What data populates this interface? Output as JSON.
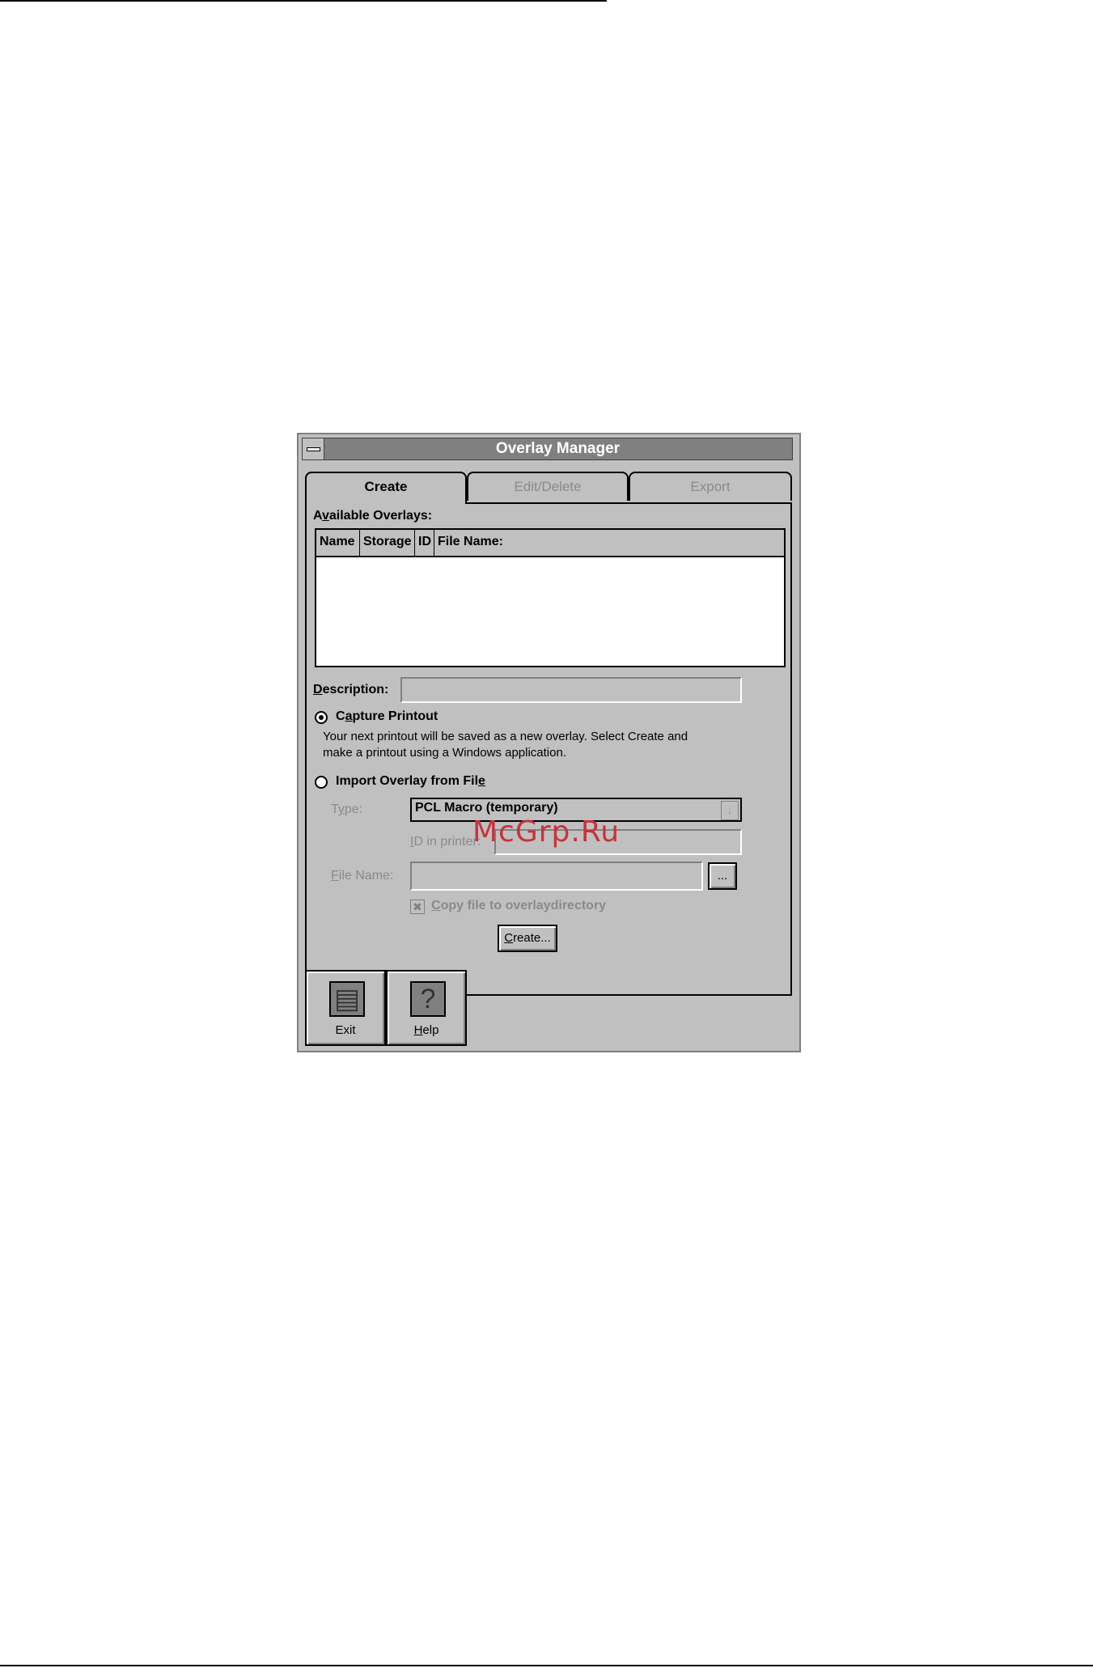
{
  "window": {
    "title": "Overlay Manager"
  },
  "tabs": [
    {
      "label": "Create",
      "state": "active"
    },
    {
      "label": "Edit/Delete",
      "state": "disabled"
    },
    {
      "label": "Export",
      "state": "disabled"
    }
  ],
  "overlays": {
    "label_pre": "A",
    "label_u": "v",
    "label_post": "ailable Overlays:",
    "columns": [
      "Name",
      "Storage",
      "ID",
      "File Name:"
    ]
  },
  "description": {
    "label_u": "D",
    "label_post": "escription:",
    "value": ""
  },
  "capture": {
    "label_pre": "C",
    "label_u": "a",
    "label_post": "pture Printout",
    "selected": true,
    "text_line1": "Your next printout will be saved as a new overlay. Select Create and",
    "text_line2": "make a printout using a Windows application."
  },
  "import": {
    "label_pre": "Import Overlay from Fil",
    "label_u": "e",
    "selected": false,
    "type_label_pre": "T",
    "type_label_u": "y",
    "type_label_post": "pe:",
    "type_value": "PCL Macro (temporary)",
    "id_label_u": "I",
    "id_label_post": "D in printer:",
    "file_label_u": "F",
    "file_label_post": "ile Name:",
    "browse_label": "...",
    "copy_label_u": "C",
    "copy_label_post": "opy file to overlaydirectory",
    "copy_checked": true
  },
  "create_button": {
    "label_u": "C",
    "label_post": "reate..."
  },
  "footer": {
    "exit_label": "Exit",
    "help_label_u": "H",
    "help_label_post": "elp"
  },
  "watermark": "McGrp.Ru"
}
